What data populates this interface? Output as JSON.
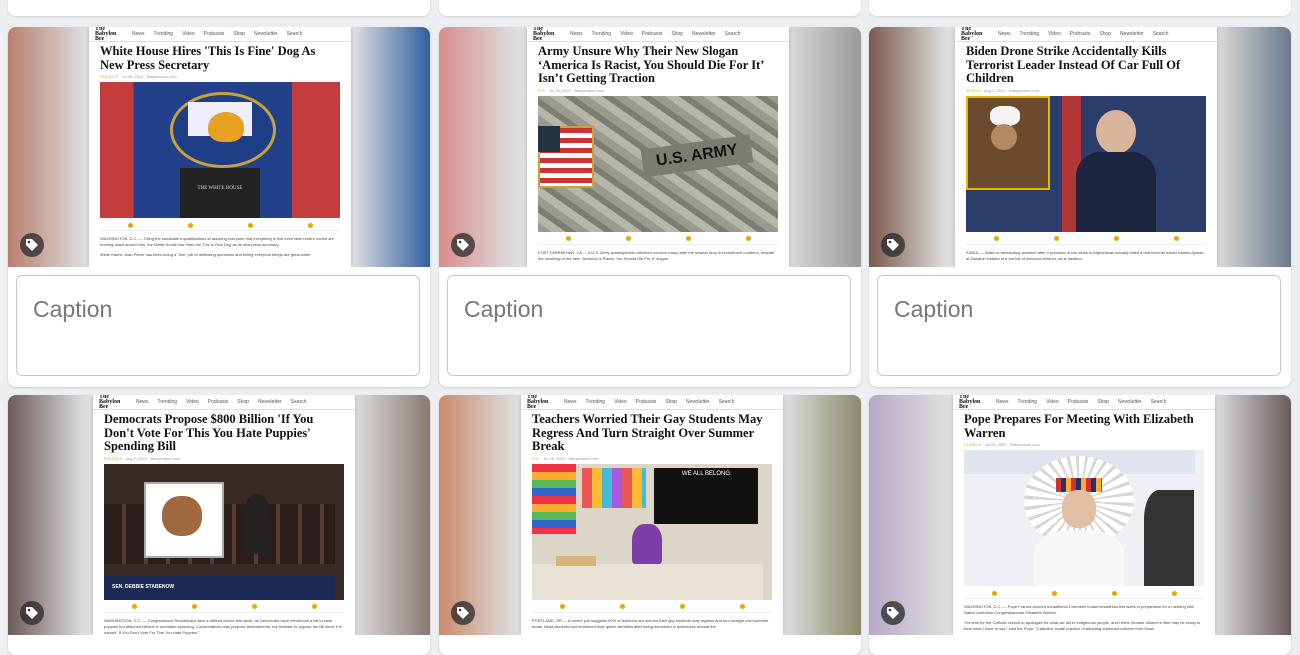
{
  "site_nav": {
    "logo_top": "The",
    "logo_name": "Babylon Bee",
    "links": [
      "News",
      "Trending",
      "Video",
      "Podcasts",
      "Shop",
      "Newsletter",
      "Search"
    ]
  },
  "caption_placeholder": "Caption",
  "cards": [
    {
      "headline": "White House Hires 'This Is Fine' Dog As New Press Secretary",
      "meta_tag": "POLITICS",
      "meta_date": "Jul 26, 2022 · Babylonbee.com",
      "body": [
        "WASHINGTON, D.C. — Citing the candidate's qualifications at assuring everyone that everything is fine even when entire rooms are burning down around him, the White House has hired the This Is Fine Dog as its new press secretary.",
        "While Karine Jean-Pierre has been doing a \"fine\" job of deflecting questions and telling everyone things are great when"
      ],
      "photo_label": "THE WHITE HOUSE",
      "blur_colors": [
        "#b8806e",
        "#2f5fa0"
      ]
    },
    {
      "headline": "Army Unsure Why Their New Slogan ‘America Is Racist, You Should Die For It’ Isn’t Getting Traction",
      "meta_tag": "U.S.",
      "meta_date": "Jul 26, 2022 · Babylonbee.com",
      "body": [
        "FORT FARRAKHAN, CA — A U.S. Army spokesperson admitted concern today after the newest drop in recruitment numbers, despite the unveiling of the new \"America Is Racist, You Should Die For It\" slogan.",
        "Colonel Kip Shirtstaff said the Army will continue to push for diversity in hopes of drawing more new recruits. \"It's just"
      ],
      "photo_label": "U.S. ARMY",
      "blur_colors": [
        "#d98c8c",
        "#9a9a9a"
      ]
    },
    {
      "headline": "Biden Drone Strike Accidentally Kills Terrorist Leader Instead Of Car Full Of Children",
      "meta_tag": "WORLD",
      "meta_date": "Aug 2, 2022 · Babylonbee.com",
      "body": [
        "KABUL — Biden is demanding answers after a precision drone strike in Afghanistan actually killed a real terrorist leader named Ayman al-Zawahiri instead of a car full of innocent children, as is tradition.",
        "\"Come on, folks, we all know what drone strikes are for,\" said the angry President in an 3:25. Surprise fell by mistake for a"
      ],
      "photo_label": "",
      "blur_colors": [
        "#7a5a4a",
        "#6c7a8c"
      ]
    },
    {
      "headline": "Democrats Propose $800 Billion 'If You Don't Vote For This You Hate Puppies' Spending Bill",
      "meta_tag": "POLITICS",
      "meta_date": "Aug 2, 2022 · Babylonbee.com",
      "body": [
        "WASHINGTON, D.C. — Congressional Republicans face a difficult choice this week, as Democrats have introduced a bill to save puppies but attached billions in unrelated spending. Conservatives may propose amendments, but hesitate to oppose the bill since it is named \"If You Don't Vote For This You Hate Puppies.\"",
        ""
      ],
      "photo_label": "SEN. DEBBIE STABENOW",
      "blur_colors": [
        "#6e5a58",
        "#8a7a72"
      ]
    },
    {
      "headline": "Teachers Worried Their Gay Students May Regress And Turn Straight Over Summer Break",
      "meta_tag": "U.S.",
      "meta_date": "Jul 28, 2022 · Babylonbee.com",
      "body": [
        "PORTLAND, OR — A recent poll suggests 90% of teachers are worried their gay students may regress and turn straight over summer break. Most students had embraced their queer identities after being immersed in queerness around the",
        "clock for the entire school year. Now, those students are trapped with their bigoted, traditional parents who may brainwash"
      ],
      "photo_label": "WE ALL BELONG",
      "blur_colors": [
        "#c98a6a",
        "#8a8a6a"
      ]
    },
    {
      "headline": "Pope Prepares For Meeting With Elizabeth Warren",
      "meta_tag": "CHURCH",
      "meta_date": "Jul 26, 2022 · Babylonbee.com",
      "body": [
        "WASHINGTON, D.C. — Pope Francis donned a traditional Cherokee Indian headdress this week in preparation for a meeting with Native American Congresswoman Elizabeth Warren.",
        "\"It's time for the Catholic church to apologize for what we did to indigenous people, and I think Senator Warren's tribe may be ready to hear what I have to say,\" said the Pope. \"Catholics' brutal practice of adopting orphaned children from those"
      ],
      "photo_label": "",
      "blur_colors": [
        "#b8a8c8",
        "#6a5a5a"
      ]
    }
  ]
}
